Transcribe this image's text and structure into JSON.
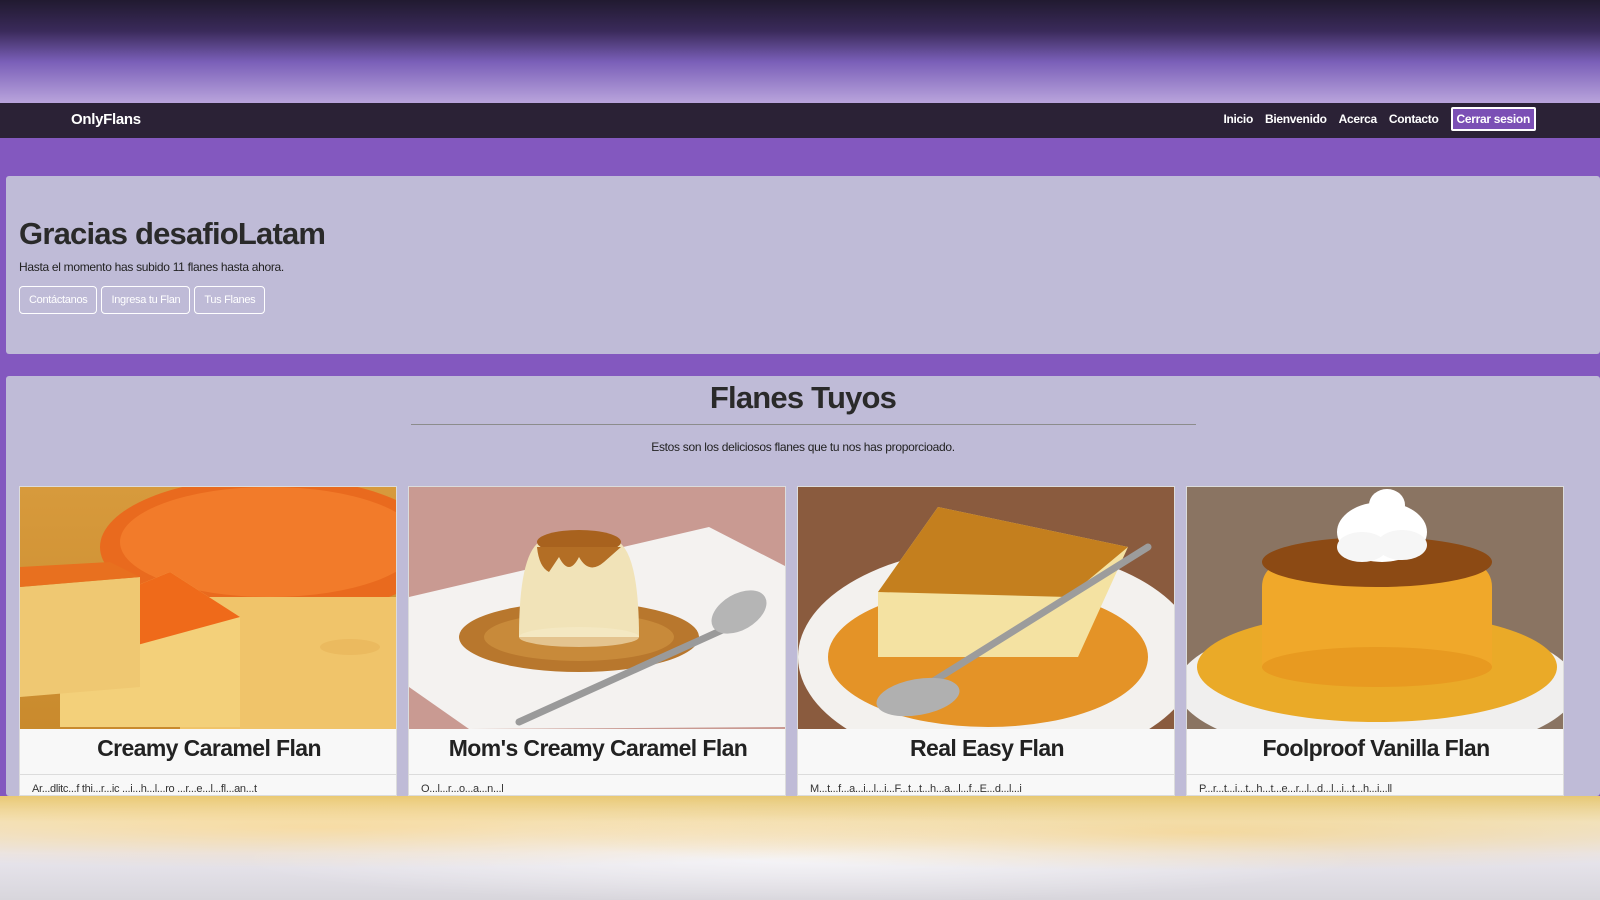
{
  "navbar": {
    "brand": "OnlyFlans",
    "links": [
      "Inicio",
      "Bienvenido",
      "Acerca",
      "Contacto"
    ],
    "logout": "Cerrar sesion"
  },
  "welcome": {
    "title": "Gracias desafioLatam",
    "text": "Hasta el momento has subido 11 flanes hasta ahora.",
    "buttons": [
      "Contáctanos",
      "Ingresa tu Flan",
      "Tus Flanes"
    ]
  },
  "section": {
    "title": "Flanes Tuyos",
    "description": "Estos son los deliciosos flanes que tu nos has proporcioado."
  },
  "cards": [
    {
      "title": "Creamy Caramel Flan",
      "text": "Ar...dlitc...f thi...r...ic ...i...h...l...ro ...r...e...l...fl...an...t",
      "icon": "caramel-flan-sliced-image"
    },
    {
      "title": "Mom's Creamy Caramel Flan",
      "text": "O...l...r...o...a...n...l",
      "icon": "caramel-flan-spoon-image"
    },
    {
      "title": "Real Easy Flan",
      "text": "M...t...f...a...i...l...i...F...t...t...h...a...l...f...E...d...l...i",
      "icon": "flan-slice-spoon-image"
    },
    {
      "title": "Foolproof Vanilla Flan",
      "text": "P...r...t...i...t...h...t...e...r...l...d...l...i...t...h...i...ll",
      "icon": "vanilla-flan-cream-image"
    }
  ],
  "colors": {
    "navbar_bg": "#2b2236",
    "page_bg": "#8358bf",
    "card_bg": "#bfbbd7",
    "logout_bg": "#7b4fb5"
  }
}
